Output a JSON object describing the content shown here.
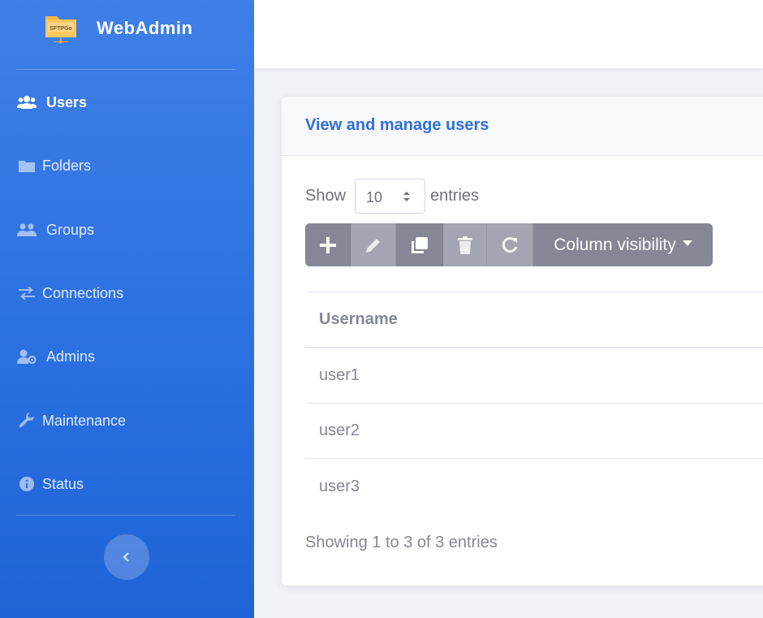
{
  "brand": {
    "logo_text": "SFTPGo",
    "title": "WebAdmin"
  },
  "sidebar": {
    "items": [
      {
        "label": "Users",
        "icon": "users-icon",
        "active": true
      },
      {
        "label": "Folders",
        "icon": "folder-icon",
        "active": false
      },
      {
        "label": "Groups",
        "icon": "user-group-icon",
        "active": false
      },
      {
        "label": "Connections",
        "icon": "exchange-icon",
        "active": false
      },
      {
        "label": "Admins",
        "icon": "user-cog-icon",
        "active": false
      },
      {
        "label": "Maintenance",
        "icon": "wrench-icon",
        "active": false
      },
      {
        "label": "Status",
        "icon": "info-circle-icon",
        "active": false
      }
    ],
    "toggle_icon": "chevron-left-icon"
  },
  "card": {
    "title": "View and manage users"
  },
  "length_menu": {
    "prefix": "Show",
    "value": "10",
    "suffix": "entries"
  },
  "toolbar": {
    "buttons": [
      {
        "icon": "plus-icon",
        "disabled": false
      },
      {
        "icon": "pencil-icon",
        "disabled": true
      },
      {
        "icon": "clone-icon",
        "disabled": false
      },
      {
        "icon": "trash-icon",
        "disabled": true
      },
      {
        "icon": "refresh-icon",
        "disabled": true
      }
    ],
    "colvis_label": "Column visibility"
  },
  "table": {
    "headers": [
      "Username"
    ],
    "rows": [
      [
        "user1"
      ],
      [
        "user2"
      ],
      [
        "user3"
      ]
    ]
  },
  "info": "Showing 1 to 3 of 3 entries",
  "colors": {
    "sidebar_top": "#3f7fe7",
    "sidebar_bottom": "#1f63d6",
    "accent": "#2f6fd9",
    "button_gray": "#858796",
    "text_gray": "#858796"
  }
}
